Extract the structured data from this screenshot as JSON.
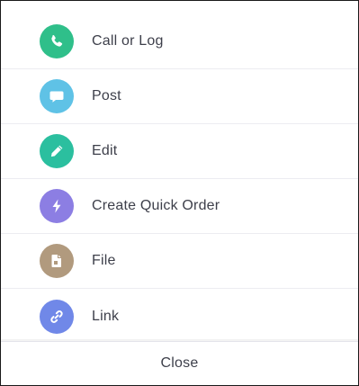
{
  "actions": [
    {
      "label": "Call or Log",
      "icon": "phone-icon",
      "color": "#2fbf8a"
    },
    {
      "label": "Post",
      "icon": "chat-bubble-icon",
      "color": "#5fc2e6"
    },
    {
      "label": "Edit",
      "icon": "pencil-icon",
      "color": "#2bbf9f"
    },
    {
      "label": "Create Quick Order",
      "icon": "lightning-icon",
      "color": "#8c7ee3"
    },
    {
      "label": "File",
      "icon": "document-icon",
      "color": "#b19a7e"
    },
    {
      "label": "Link",
      "icon": "link-icon",
      "color": "#7088e8"
    }
  ],
  "footer": {
    "close_label": "Close"
  }
}
